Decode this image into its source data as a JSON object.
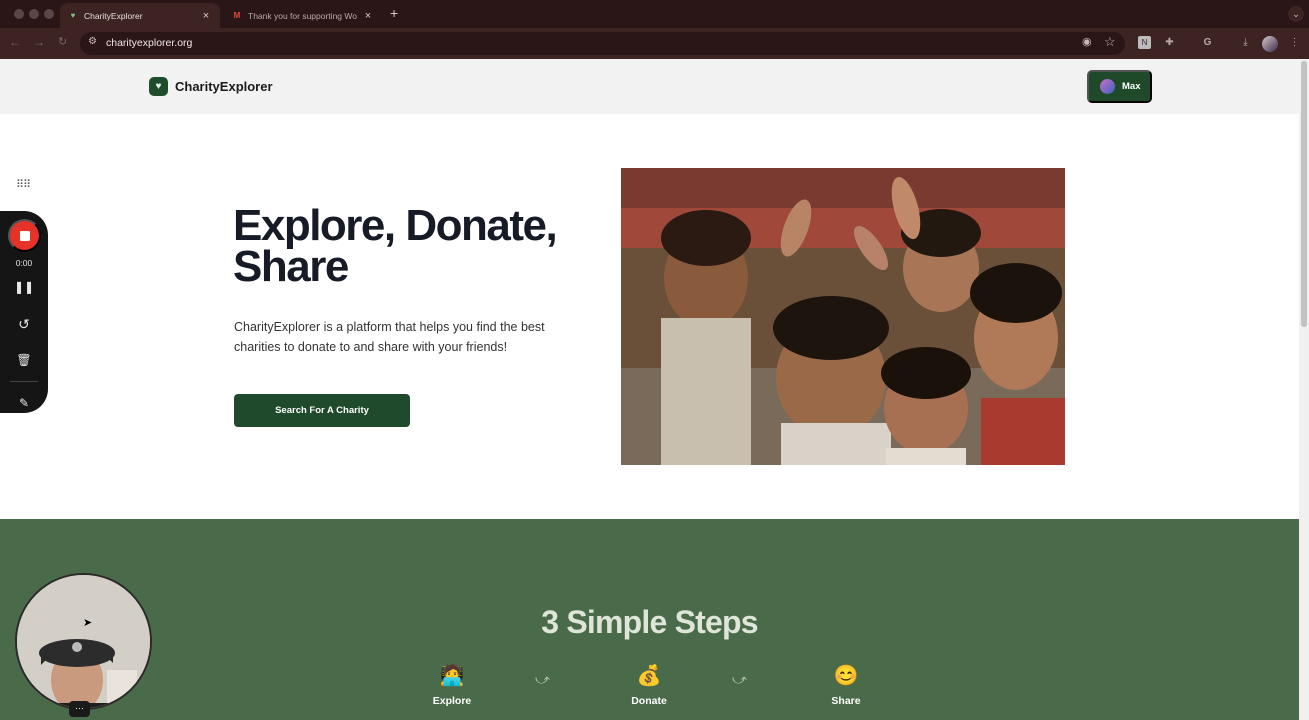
{
  "browser": {
    "tabs": [
      {
        "title": "CharityExplorer",
        "active": true,
        "favicon": "heart-favicon"
      },
      {
        "title": "Thank you for supporting Wo",
        "active": false,
        "favicon": "gmail-favicon"
      }
    ],
    "url": "charityexplorer.org"
  },
  "site": {
    "brand": "CharityExplorer",
    "user_name": "Max",
    "hero": {
      "title": "Explore, Donate, Share",
      "description": "CharityExplorer is a platform that helps you find the best charities to donate to and share with your friends!",
      "cta_label": "Search For A Charity"
    },
    "steps": {
      "title": "3 Simple Steps",
      "items": [
        {
          "label": "Explore",
          "emoji": "🧑‍💻"
        },
        {
          "label": "Donate",
          "emoji": "💰"
        },
        {
          "label": "Share",
          "emoji": "😊"
        }
      ]
    }
  },
  "recorder": {
    "time": "0:00"
  },
  "colors": {
    "brand_green": "#1f4a2b",
    "section_green": "#4a6b49",
    "record_red": "#e5332a"
  }
}
